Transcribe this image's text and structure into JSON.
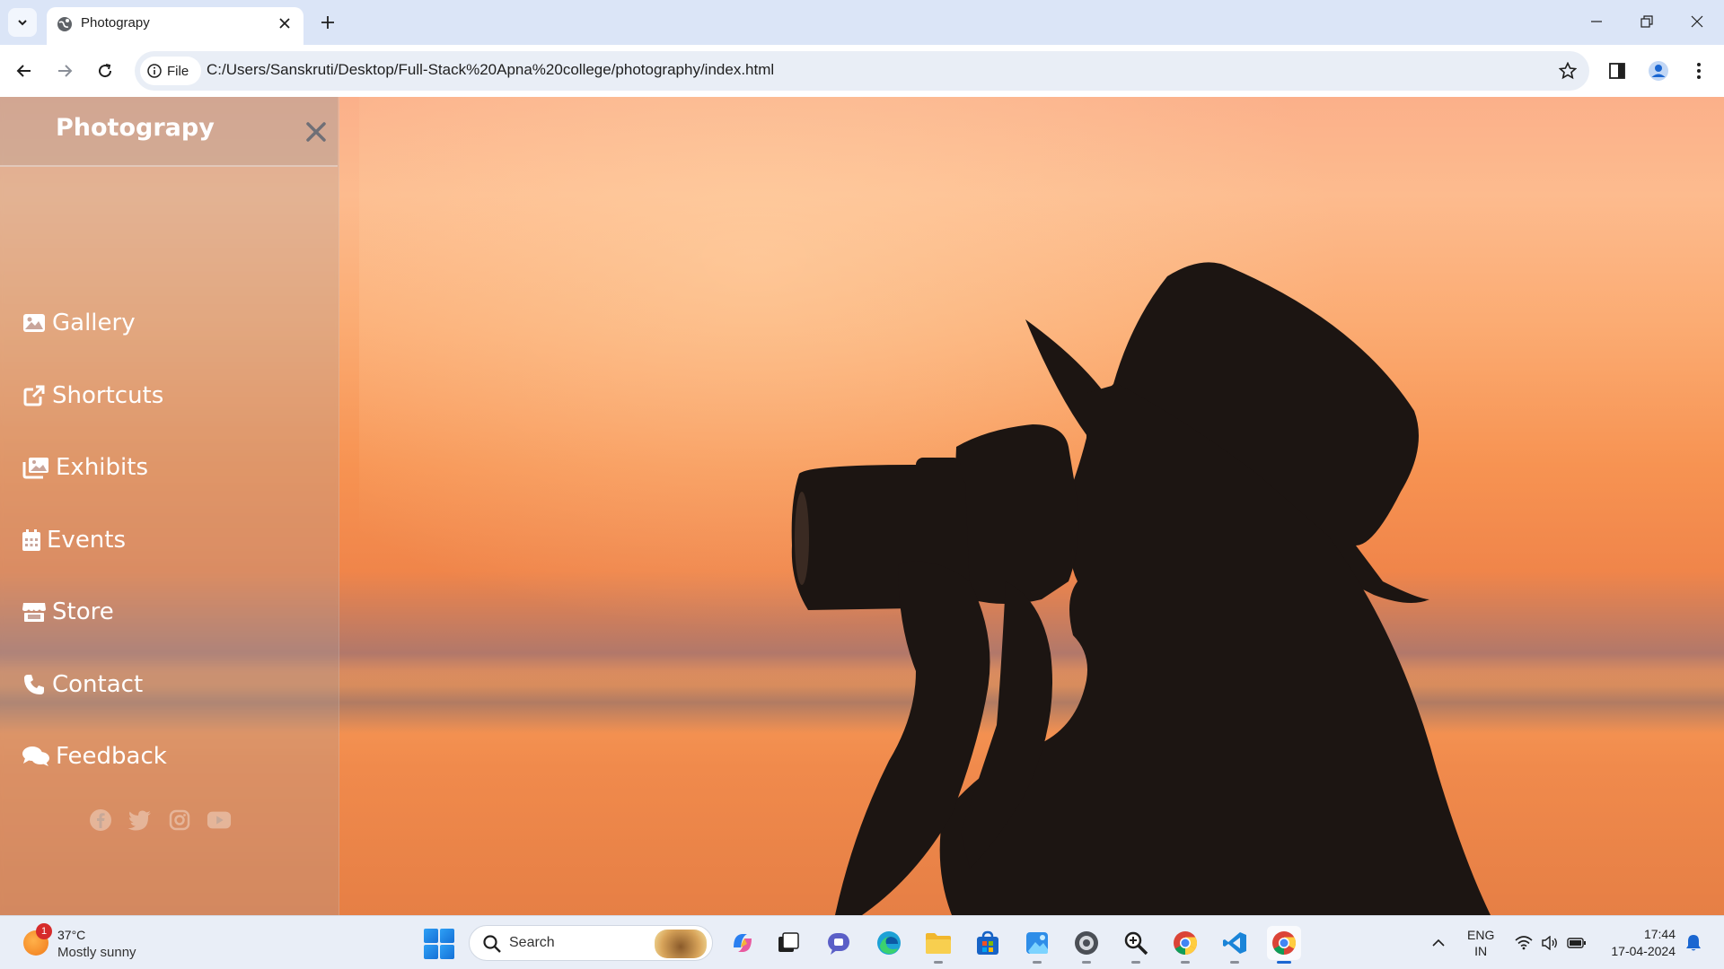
{
  "browser": {
    "tab_title": "Photograpy",
    "site_chip_label": "File",
    "url": "C:/Users/Sanskruti/Desktop/Full-Stack%20Apna%20college/photography/index.html"
  },
  "sidebar": {
    "brand": "Photograpy",
    "items": [
      {
        "label": "Gallery",
        "icon": "image-icon"
      },
      {
        "label": "Shortcuts",
        "icon": "external-link-icon"
      },
      {
        "label": "Exhibits",
        "icon": "photo-album-icon"
      },
      {
        "label": "Events",
        "icon": "calendar-icon"
      },
      {
        "label": "Store",
        "icon": "store-icon"
      },
      {
        "label": "Contact",
        "icon": "phone-icon"
      },
      {
        "label": "Feedback",
        "icon": "comments-icon"
      }
    ],
    "social": [
      "facebook-icon",
      "twitter-icon",
      "instagram-icon",
      "youtube-icon"
    ]
  },
  "taskbar": {
    "weather_temp": "37°C",
    "weather_desc": "Mostly sunny",
    "weather_badge": "1",
    "search_label": "Search",
    "lang_line1": "ENG",
    "lang_line2": "IN",
    "time": "17:44",
    "date": "17-04-2024"
  },
  "colors": {
    "sky_top": "#fbb08a",
    "sky_mid": "#f79352",
    "sidebar_overlay": "rgba(170,160,160,0.30)",
    "taskbar_bg": "#e9eef7",
    "accent_blue": "#1a66d1"
  }
}
